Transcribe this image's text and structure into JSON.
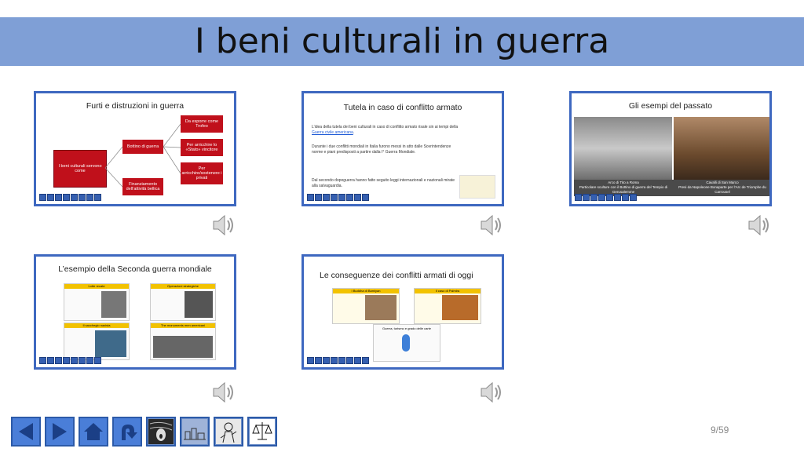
{
  "title": "I beni culturali in guerra",
  "slide_number": "9/59",
  "thumbnails": [
    {
      "title": "Furti e distruzioni in guerra",
      "root": "I beni culturali servono come",
      "branch1": "Bottino di guerra",
      "branch2": "Finanziamento dell’attività bellica",
      "leaf1": "Da esporre come Trofeo",
      "leaf2": "Per arricchire lo «Stato» vincitore",
      "leaf3": "Per arricchire/sostenere i privati"
    },
    {
      "title": "Tutela in caso di conflitto armato",
      "p1_prefix": "L’idea della tutela dei beni culturali in caso di conflitto armato risale sin ai tempi della",
      "p1_link": "Guerra civile americana",
      "p2": "Durante i due conflitti mondiali in Italia furono messi in atto dalle Sovrintendenze norme e piani predisposti a partire dalla I° Guerra Mondiale.",
      "p3": "Dal secondo dopoguerra hanno fatto seguito leggi internazionali e nazionali mirate alla salvaguardia."
    },
    {
      "title": "Gli esempi del passato",
      "caption_left": "Arco di Tito a Roma\nParticolare sculture con il Bottino di guerra del Tempio di Gerusalemme",
      "caption_right": "Cavalli di San Marco\nPresi da Napoleone Bonaparte per l’Arc de Triomphe du Carrousel"
    },
    {
      "title": "L’esempio della Seconda guerra mondiale",
      "box1": "Lotte recate",
      "box2": "Operazioni strategiche",
      "box3": "Il sacchegio nazista",
      "box4": "The monuments men americani"
    },
    {
      "title": "Le conseguenze dei conflitti armati di oggi",
      "box1": "I Buddha di Bamiyan",
      "box2": "Il caso di Palmira",
      "box3": "Guerra, turismo e grado delle carte"
    }
  ],
  "nav_buttons": [
    {
      "icon": "arrow-left-icon"
    },
    {
      "icon": "arrow-right-icon"
    },
    {
      "icon": "home-icon"
    },
    {
      "icon": "return-icon"
    },
    {
      "icon": "scream-painting-icon"
    },
    {
      "icon": "city-sketch-icon"
    },
    {
      "icon": "soldier-sketch-icon"
    },
    {
      "icon": "scales-icon"
    }
  ]
}
